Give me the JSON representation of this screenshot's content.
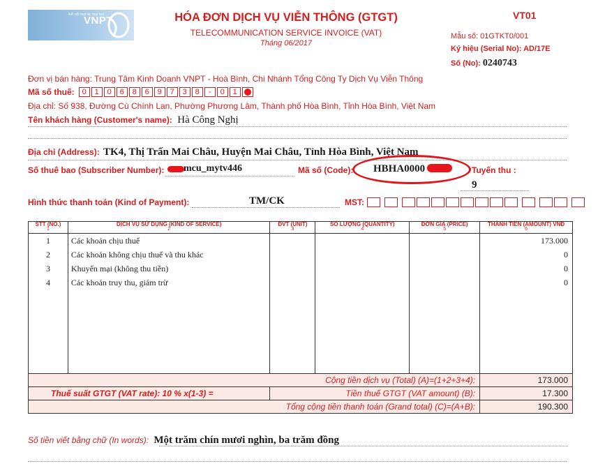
{
  "header": {
    "logo_text": "VNPT",
    "logo_tagline": "Kết nối mọi lúc mọi nơi",
    "title": "HÓA ĐƠN DỊCH VỤ VIỄN THÔNG (GTGT)",
    "subtitle": "TELECOMMUNICATION SERVICE INVOICE (VAT)",
    "month": "Tháng 06/2017",
    "code": "VT01",
    "form_no": "Mẫu số: 01GTKT0/001",
    "serial_label": "Ký hiệu (Serial No): AD/17E",
    "number_label": "Số (No):",
    "number_value": "0240743"
  },
  "seller": {
    "unit": "Đơn vị bán hàng: Trung Tâm Kinh Doanh VNPT - Hoà Bình, Chi Nhánh Tổng Công Ty Dịch Vụ Viễn Thông",
    "tax_label": "Mã số thuế:",
    "tax_digits": [
      "0",
      "1",
      "0",
      "6",
      "8",
      "6",
      "9",
      "7",
      "3",
      "8",
      "-",
      "0",
      "1",
      ""
    ],
    "address": "Địa chỉ: Số 938, Đường Cù Chính Lan, Phường Phương Lâm, Thành phố Hòa Bình, Tỉnh Hòa Bình, Việt Nam"
  },
  "customer": {
    "name_label": "Tên khách hàng (Customer's name):",
    "name_value": "Hà Công Nghị",
    "address_label": "Địa chỉ (Address):",
    "address_value": "TK4, Thị Trấn Mai Châu, Huyện Mai Châu, Tỉnh Hòa Bình, Việt Nam",
    "subscriber_label": "Số thuê bao (Subscriber Number):",
    "subscriber_value": "mcu_mytv446",
    "code_label": "Mã số (Code):",
    "code_value": "HBHA0000",
    "route_label": "Tuyến thu :",
    "route_value": "9",
    "payment_label": "Hình thức thanh toán (Kind of Payment):",
    "payment_value": "TM/CK",
    "mst_label": "MST:"
  },
  "table": {
    "headers": [
      {
        "label": "STT (NO.)",
        "num": "1"
      },
      {
        "label": "DỊCH VỤ SỬ DỤNG (KIND OF SERVICE)",
        "num": "2"
      },
      {
        "label": "ĐVT (UNIT)",
        "num": "3"
      },
      {
        "label": "SỐ LƯỢNG (QUANTITY)",
        "num": "4"
      },
      {
        "label": "ĐƠN GIÁ (PRICE)",
        "num": "5"
      },
      {
        "label": "THÀNH TIỀN (AMOUNT) VNĐ",
        "num": "6"
      }
    ],
    "rows": [
      {
        "no": "1",
        "service": "Các khoản chịu thuế",
        "amount": "173.000"
      },
      {
        "no": "2",
        "service": "Các khoản không chịu thuế và thu khác",
        "amount": "0"
      },
      {
        "no": "3",
        "service": "Khuyến mại (không thu tiền)",
        "amount": "0"
      },
      {
        "no": "4",
        "service": "Các khoản truy thu, giảm trừ",
        "amount": "0"
      }
    ],
    "total_label": "Cộng tiền dịch vụ (Total) (A)=(1+2+3+4):",
    "total_value": "173.000",
    "vat_rate_label": "Thuế suất GTGT (VAT rate): 10 % x(1-3) =",
    "vat_amount_label": "Tiền thuế GTGT (VAT amount) (B):",
    "vat_amount_value": "17.300",
    "grand_label": "Tổng cộng tiền thanh toán (Grand total) (C)=(A+B):",
    "grand_value": "190.300"
  },
  "words": {
    "label": "Số tiền viết bằng chữ (In words):",
    "value": "Một trăm chín mươi nghìn, ba trăm đồng"
  },
  "colors": {
    "accent": "#d21f1f",
    "highlight": "#e0151b",
    "total_bg": "#fbe9e6"
  }
}
